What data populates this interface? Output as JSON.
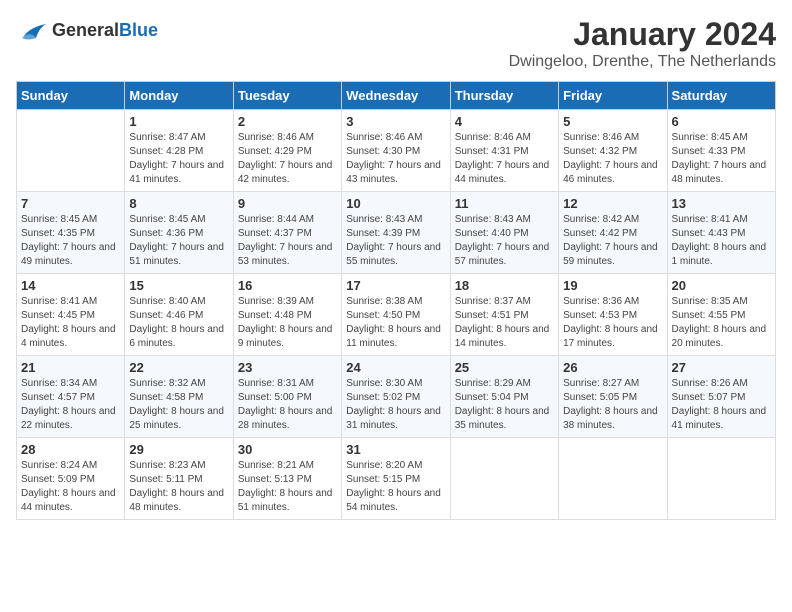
{
  "header": {
    "logo": {
      "general": "General",
      "blue": "Blue"
    },
    "title": "January 2024",
    "location": "Dwingeloo, Drenthe, The Netherlands"
  },
  "calendar": {
    "days_of_week": [
      "Sunday",
      "Monday",
      "Tuesday",
      "Wednesday",
      "Thursday",
      "Friday",
      "Saturday"
    ],
    "weeks": [
      [
        {
          "day": "",
          "sunrise": "",
          "sunset": "",
          "daylight": ""
        },
        {
          "day": "1",
          "sunrise": "Sunrise: 8:47 AM",
          "sunset": "Sunset: 4:28 PM",
          "daylight": "Daylight: 7 hours and 41 minutes."
        },
        {
          "day": "2",
          "sunrise": "Sunrise: 8:46 AM",
          "sunset": "Sunset: 4:29 PM",
          "daylight": "Daylight: 7 hours and 42 minutes."
        },
        {
          "day": "3",
          "sunrise": "Sunrise: 8:46 AM",
          "sunset": "Sunset: 4:30 PM",
          "daylight": "Daylight: 7 hours and 43 minutes."
        },
        {
          "day": "4",
          "sunrise": "Sunrise: 8:46 AM",
          "sunset": "Sunset: 4:31 PM",
          "daylight": "Daylight: 7 hours and 44 minutes."
        },
        {
          "day": "5",
          "sunrise": "Sunrise: 8:46 AM",
          "sunset": "Sunset: 4:32 PM",
          "daylight": "Daylight: 7 hours and 46 minutes."
        },
        {
          "day": "6",
          "sunrise": "Sunrise: 8:45 AM",
          "sunset": "Sunset: 4:33 PM",
          "daylight": "Daylight: 7 hours and 48 minutes."
        }
      ],
      [
        {
          "day": "7",
          "sunrise": "Sunrise: 8:45 AM",
          "sunset": "Sunset: 4:35 PM",
          "daylight": "Daylight: 7 hours and 49 minutes."
        },
        {
          "day": "8",
          "sunrise": "Sunrise: 8:45 AM",
          "sunset": "Sunset: 4:36 PM",
          "daylight": "Daylight: 7 hours and 51 minutes."
        },
        {
          "day": "9",
          "sunrise": "Sunrise: 8:44 AM",
          "sunset": "Sunset: 4:37 PM",
          "daylight": "Daylight: 7 hours and 53 minutes."
        },
        {
          "day": "10",
          "sunrise": "Sunrise: 8:43 AM",
          "sunset": "Sunset: 4:39 PM",
          "daylight": "Daylight: 7 hours and 55 minutes."
        },
        {
          "day": "11",
          "sunrise": "Sunrise: 8:43 AM",
          "sunset": "Sunset: 4:40 PM",
          "daylight": "Daylight: 7 hours and 57 minutes."
        },
        {
          "day": "12",
          "sunrise": "Sunrise: 8:42 AM",
          "sunset": "Sunset: 4:42 PM",
          "daylight": "Daylight: 7 hours and 59 minutes."
        },
        {
          "day": "13",
          "sunrise": "Sunrise: 8:41 AM",
          "sunset": "Sunset: 4:43 PM",
          "daylight": "Daylight: 8 hours and 1 minute."
        }
      ],
      [
        {
          "day": "14",
          "sunrise": "Sunrise: 8:41 AM",
          "sunset": "Sunset: 4:45 PM",
          "daylight": "Daylight: 8 hours and 4 minutes."
        },
        {
          "day": "15",
          "sunrise": "Sunrise: 8:40 AM",
          "sunset": "Sunset: 4:46 PM",
          "daylight": "Daylight: 8 hours and 6 minutes."
        },
        {
          "day": "16",
          "sunrise": "Sunrise: 8:39 AM",
          "sunset": "Sunset: 4:48 PM",
          "daylight": "Daylight: 8 hours and 9 minutes."
        },
        {
          "day": "17",
          "sunrise": "Sunrise: 8:38 AM",
          "sunset": "Sunset: 4:50 PM",
          "daylight": "Daylight: 8 hours and 11 minutes."
        },
        {
          "day": "18",
          "sunrise": "Sunrise: 8:37 AM",
          "sunset": "Sunset: 4:51 PM",
          "daylight": "Daylight: 8 hours and 14 minutes."
        },
        {
          "day": "19",
          "sunrise": "Sunrise: 8:36 AM",
          "sunset": "Sunset: 4:53 PM",
          "daylight": "Daylight: 8 hours and 17 minutes."
        },
        {
          "day": "20",
          "sunrise": "Sunrise: 8:35 AM",
          "sunset": "Sunset: 4:55 PM",
          "daylight": "Daylight: 8 hours and 20 minutes."
        }
      ],
      [
        {
          "day": "21",
          "sunrise": "Sunrise: 8:34 AM",
          "sunset": "Sunset: 4:57 PM",
          "daylight": "Daylight: 8 hours and 22 minutes."
        },
        {
          "day": "22",
          "sunrise": "Sunrise: 8:32 AM",
          "sunset": "Sunset: 4:58 PM",
          "daylight": "Daylight: 8 hours and 25 minutes."
        },
        {
          "day": "23",
          "sunrise": "Sunrise: 8:31 AM",
          "sunset": "Sunset: 5:00 PM",
          "daylight": "Daylight: 8 hours and 28 minutes."
        },
        {
          "day": "24",
          "sunrise": "Sunrise: 8:30 AM",
          "sunset": "Sunset: 5:02 PM",
          "daylight": "Daylight: 8 hours and 31 minutes."
        },
        {
          "day": "25",
          "sunrise": "Sunrise: 8:29 AM",
          "sunset": "Sunset: 5:04 PM",
          "daylight": "Daylight: 8 hours and 35 minutes."
        },
        {
          "day": "26",
          "sunrise": "Sunrise: 8:27 AM",
          "sunset": "Sunset: 5:05 PM",
          "daylight": "Daylight: 8 hours and 38 minutes."
        },
        {
          "day": "27",
          "sunrise": "Sunrise: 8:26 AM",
          "sunset": "Sunset: 5:07 PM",
          "daylight": "Daylight: 8 hours and 41 minutes."
        }
      ],
      [
        {
          "day": "28",
          "sunrise": "Sunrise: 8:24 AM",
          "sunset": "Sunset: 5:09 PM",
          "daylight": "Daylight: 8 hours and 44 minutes."
        },
        {
          "day": "29",
          "sunrise": "Sunrise: 8:23 AM",
          "sunset": "Sunset: 5:11 PM",
          "daylight": "Daylight: 8 hours and 48 minutes."
        },
        {
          "day": "30",
          "sunrise": "Sunrise: 8:21 AM",
          "sunset": "Sunset: 5:13 PM",
          "daylight": "Daylight: 8 hours and 51 minutes."
        },
        {
          "day": "31",
          "sunrise": "Sunrise: 8:20 AM",
          "sunset": "Sunset: 5:15 PM",
          "daylight": "Daylight: 8 hours and 54 minutes."
        },
        {
          "day": "",
          "sunrise": "",
          "sunset": "",
          "daylight": ""
        },
        {
          "day": "",
          "sunrise": "",
          "sunset": "",
          "daylight": ""
        },
        {
          "day": "",
          "sunrise": "",
          "sunset": "",
          "daylight": ""
        }
      ]
    ]
  }
}
